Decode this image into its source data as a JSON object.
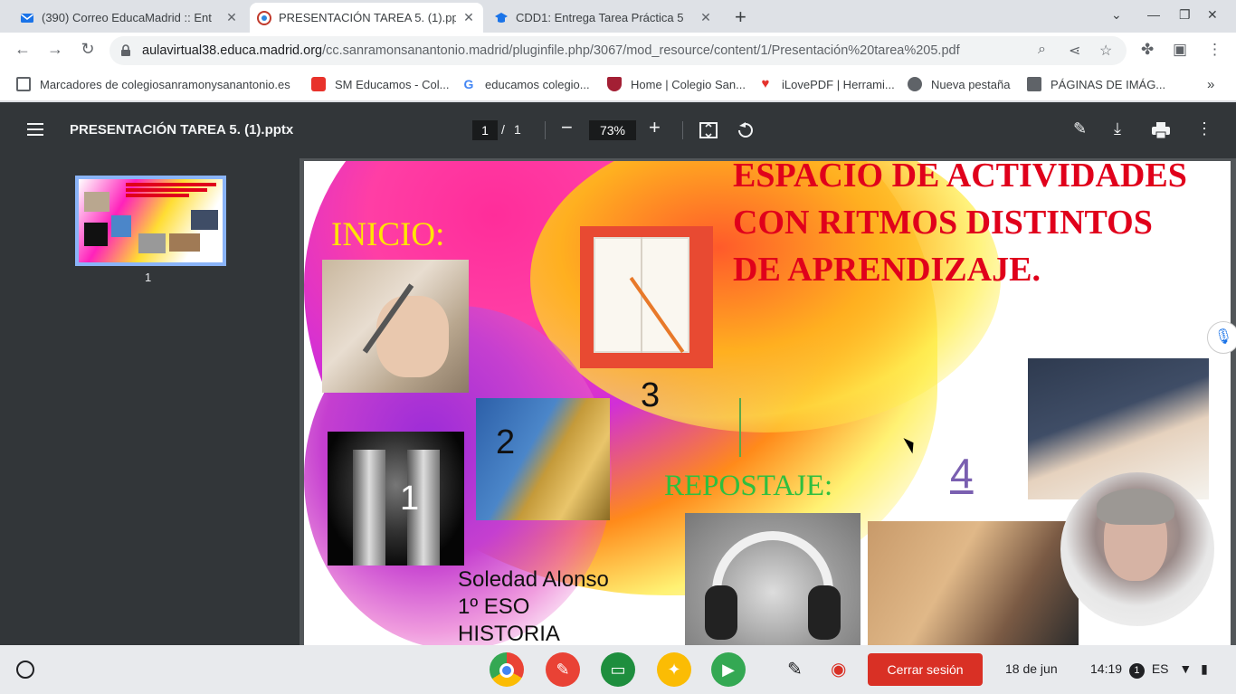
{
  "browser": {
    "tabs": [
      {
        "title": "(390) Correo EducaMadrid :: Ent",
        "icon": "mail-icon",
        "active": false
      },
      {
        "title": "PRESENTACIÓN TAREA 5. (1).pp",
        "icon": "educamadrid-icon",
        "active": true
      },
      {
        "title": "CDD1: Entrega Tarea Práctica 5",
        "icon": "moodle-icon",
        "active": false
      }
    ],
    "url_host": "aulavirtual38.educa.madrid.org",
    "url_path": "/cc.sanramonsanantonio.madrid/pluginfile.php/3067/mod_resource/content/1/Presentación%20tarea%205.pdf",
    "bookmarks": [
      {
        "label": "Marcadores de colegiosanramonysanantonio.es",
        "icon": "folder-icon",
        "color": "#5f6368"
      },
      {
        "label": "SM Educamos - Col...",
        "icon": "sm-icon",
        "color": "#e8322b"
      },
      {
        "label": "educamos colegio...",
        "icon": "google-icon",
        "color": "#4285f4"
      },
      {
        "label": "Home | Colegio San...",
        "icon": "school-crest-icon",
        "color": "#a31f34"
      },
      {
        "label": "iLovePDF | Herrami...",
        "icon": "heart-icon",
        "color": "#e5322d"
      },
      {
        "label": "Nueva pestaña",
        "icon": "globe-icon",
        "color": "#5f6368"
      },
      {
        "label": "PÁGINAS DE IMÁG...",
        "icon": "folder-icon",
        "color": "#5f6368"
      }
    ],
    "bookmarks_overflow": "»"
  },
  "pdf": {
    "title": "PRESENTACIÓN TAREA 5. (1).pptx",
    "page_current": "1",
    "page_sep": "/",
    "page_total": "1",
    "zoom": "73%",
    "thumb_label": "1"
  },
  "slide": {
    "title": "ESPACIO DE ACTIVIDADES CON RITMOS DISTINTOS DE APRENDIZAJE.",
    "inicio": "INICIO:",
    "repostaje": "REPOSTAJE:",
    "n1": "1",
    "n2": "2",
    "n3": "3",
    "n4": "4",
    "author_name": "Soledad Alonso",
    "author_course": "1º ESO",
    "author_subject": "HISTORIA"
  },
  "shelf": {
    "apps": [
      {
        "name": "chrome-icon",
        "color": "#4285f4"
      },
      {
        "name": "canvas-app-icon",
        "color": "#e94235"
      },
      {
        "name": "classroom-icon",
        "color": "#1e8e3e"
      },
      {
        "name": "keep-icon",
        "color": "#fbbc04"
      },
      {
        "name": "play-store-icon",
        "color": "#34a853"
      }
    ],
    "logout": "Cerrar sesión",
    "date": "18 de jun",
    "time": "14:19",
    "notif_count": "1",
    "lang": "ES"
  }
}
